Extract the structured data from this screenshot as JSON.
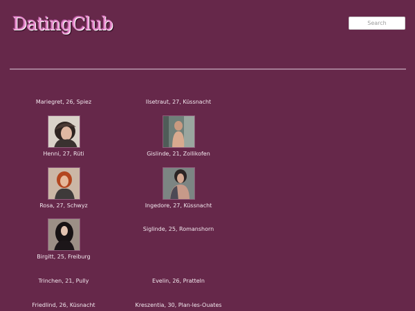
{
  "header": {
    "logo_text": "DatingClub",
    "search_placeholder": "Search"
  },
  "profiles": [
    {
      "label": "Mariegret, 26, Spiez",
      "has_photo": false
    },
    {
      "label": "Ilsetraut, 27, Küssnacht",
      "has_photo": false
    },
    {
      "label": "Henni, 27, Rüti",
      "has_photo": true
    },
    {
      "label": "Gislinde, 21, Zollikofen",
      "has_photo": true
    },
    {
      "label": "Rosa, 27, Schwyz",
      "has_photo": true
    },
    {
      "label": "Ingedore, 27, Küssnacht",
      "has_photo": true
    },
    {
      "label": "Birgitt, 25, Freiburg",
      "has_photo": true
    },
    {
      "label": "Siglinde, 25, Romanshorn",
      "has_photo": false
    },
    {
      "label": "Trinchen, 21, Pully",
      "has_photo": false
    },
    {
      "label": "Evelin, 26, Pratteln",
      "has_photo": false
    },
    {
      "label": "Friedlind, 26, Küsnacht",
      "has_photo": false
    },
    {
      "label": "Kreszentia, 30, Plan-les-Ouates",
      "has_photo": false
    }
  ]
}
